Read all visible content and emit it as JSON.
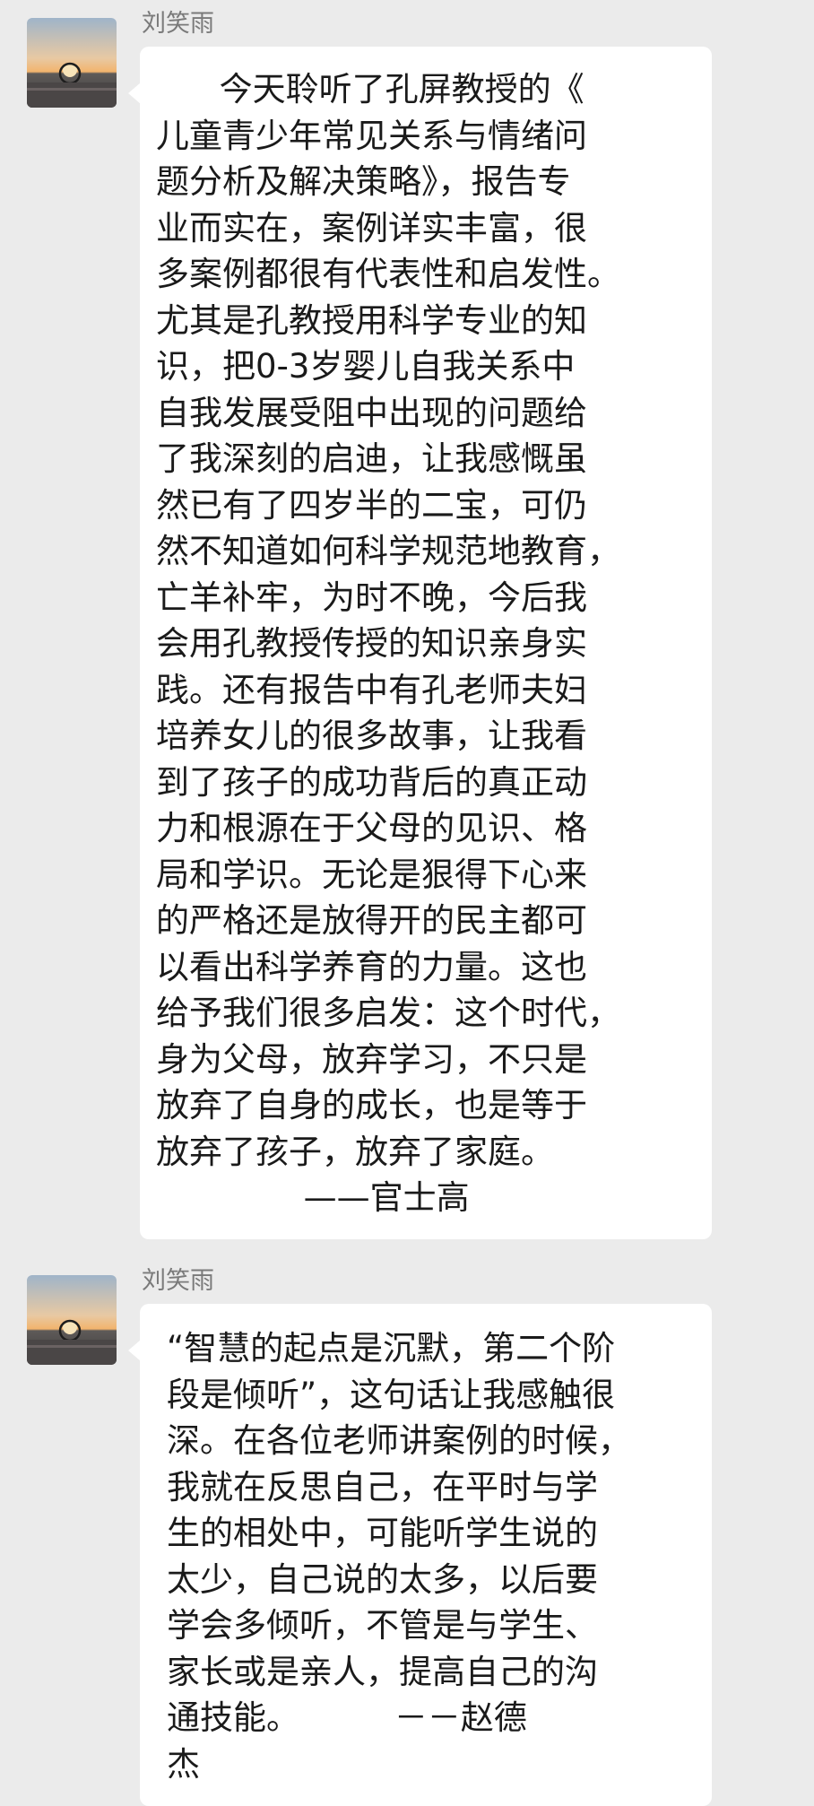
{
  "messages": [
    {
      "sender": "刘笑雨",
      "avatar_icon": "sunset-landscape-avatar",
      "lines": [
        "      今天聆听了孔屏教授的《",
        "儿童青少年常见关系与情绪问",
        "题分析及解决策略》，报告专",
        "业而实在，案例详实丰富，很",
        "多案例都很有代表性和启发性。",
        "尤其是孔教授用科学专业的知",
        "识，把0-3岁婴儿自我关系中",
        "自我发展受阻中出现的问题给",
        "了我深刻的启迪，让我感慨虽",
        "然已有了四岁半的二宝，可仍",
        "然不知道如何科学规范地教育，",
        "亡羊补牢，为时不晚，今后我",
        "会用孔教授传授的知识亲身实",
        "践。还有报告中有孔老师夫妇",
        "培养女儿的很多故事，让我看",
        "到了孩子的成功背后的真正动",
        "力和根源在于父母的见识、格",
        "局和学识。无论是狠得下心来",
        "的严格还是放得开的民主都可",
        "以看出科学养育的力量。这也",
        "给予我们很多启发：这个时代，",
        "身为父母，放弃学习，不只是",
        "放弃了自身的成长，也是等于",
        "放弃了孩子，放弃了家庭。",
        "              ——官士高"
      ]
    },
    {
      "sender": "刘笑雨",
      "avatar_icon": "sunset-landscape-avatar",
      "lines": [
        "“智慧的起点是沉默，第二个阶",
        "段是倾听”，这句话让我感触很",
        "深。在各位老师讲案例的时候，",
        "我就在反思自己，在平时与学",
        "生的相处中，可能听学生说的",
        "太少，自己说的太多，以后要",
        "学会多倾听，不管是与学生、",
        "家长或是亲人，提高自己的沟",
        "通技能。         －－赵德",
        "杰"
      ]
    }
  ]
}
